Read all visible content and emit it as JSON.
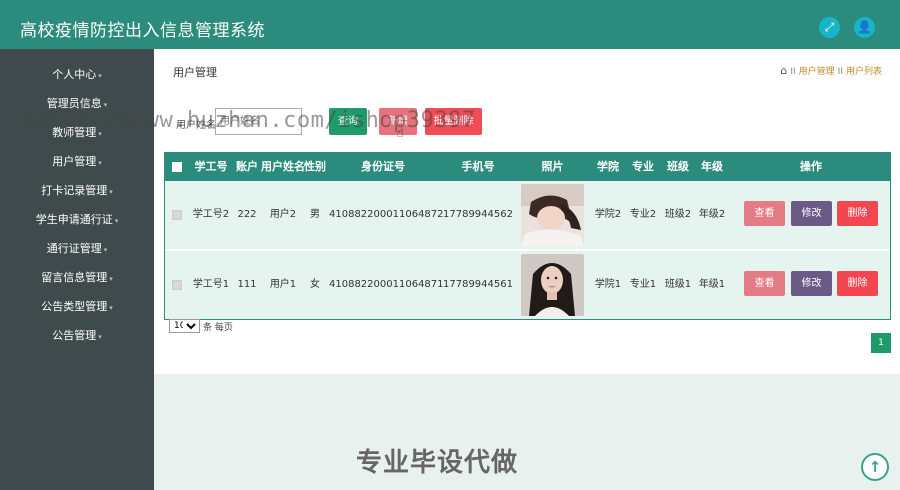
{
  "app": {
    "title": "高校疫情防控出入信息管理系统"
  },
  "sidebar": {
    "items": [
      {
        "label": "个人中心"
      },
      {
        "label": "管理员信息"
      },
      {
        "label": "教师管理"
      },
      {
        "label": "用户管理"
      },
      {
        "label": "打卡记录管理"
      },
      {
        "label": "学生申请通行证"
      },
      {
        "label": "通行证管理"
      },
      {
        "label": "留言信息管理"
      },
      {
        "label": "公告类型管理"
      },
      {
        "label": "公告管理"
      }
    ]
  },
  "page": {
    "title": "用户管理",
    "breadcrumb": [
      "用户管理",
      "用户列表"
    ]
  },
  "search": {
    "label": "用户姓名",
    "placeholder": "用户姓名",
    "search_label": "查询",
    "add_label": "新增",
    "batch_delete_label": "批量删除"
  },
  "table": {
    "headers": [
      "学工号",
      "账户",
      "用户姓名",
      "性别",
      "身份证号",
      "手机号",
      "照片",
      "学院",
      "专业",
      "班级",
      "年级",
      "操作"
    ],
    "rows": [
      {
        "student_id": "学工号2",
        "account": "222",
        "name": "用户2",
        "gender": "男",
        "id_card": "410882200011064872",
        "phone": "17789944562",
        "college": "学院2",
        "major": "专业2",
        "class": "班级2",
        "grade": "年级2"
      },
      {
        "student_id": "学工号1",
        "account": "111",
        "name": "用户1",
        "gender": "女",
        "id_card": "410882200011064871",
        "phone": "17789944561",
        "college": "学院1",
        "major": "专业1",
        "class": "班级1",
        "grade": "年级1"
      }
    ],
    "actions": {
      "view": "查看",
      "edit": "修改",
      "delete": "删除"
    }
  },
  "pagination": {
    "page_size": "10",
    "page_size_label": "条 每页",
    "current_page": "1"
  },
  "overlay": {
    "watermark": "https://www.huzhan.com/ishop39397",
    "bottom_text": "专业毕设代做"
  },
  "colors": {
    "header": "#2b8c7e",
    "sidebar": "#3f4a4c",
    "search_button": "#1f9a6a",
    "add_button": "#e8727c",
    "delete_button": "#ef4c55",
    "view_button": "#e47c86",
    "edit_button": "#6c5a86"
  },
  "icons": {
    "expand": "fullscreen-icon",
    "user": "user-icon",
    "home": "home-icon",
    "back_to_top": "arrow-up-icon"
  }
}
